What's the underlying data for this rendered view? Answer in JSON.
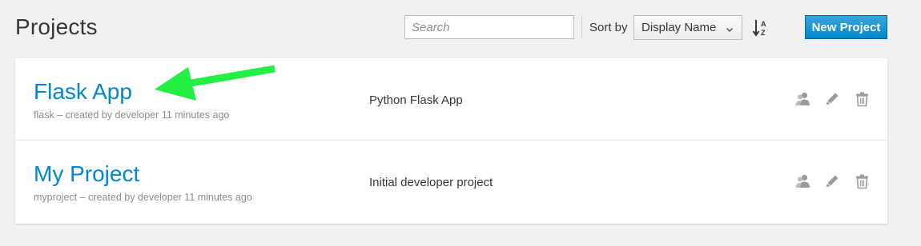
{
  "header": {
    "title": "Projects",
    "search_placeholder": "Search",
    "search_value": "",
    "sort_label": "Sort by",
    "sort_selected": "Display Name",
    "new_project_label": "New Project"
  },
  "icons": {
    "sort_direction": "sort-alpha-asc-icon",
    "chevron": "chevron-down-icon",
    "members": "users-icon",
    "edit": "pencil-icon",
    "delete": "trash-icon"
  },
  "colors": {
    "accent": "#0088ce",
    "annotation_arrow": "#22ee44"
  },
  "projects": [
    {
      "name": "Flask App",
      "meta": "flask – created by developer 11 minutes ago",
      "description": "Python Flask App"
    },
    {
      "name": "My Project",
      "meta": "myproject – created by developer 11 minutes ago",
      "description": "Initial developer project"
    }
  ]
}
